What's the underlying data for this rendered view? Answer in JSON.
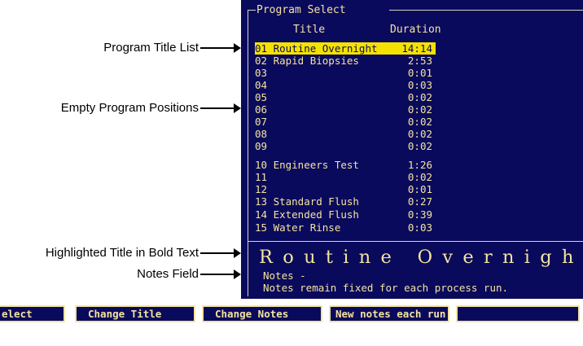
{
  "program_select": {
    "frame_title": "Program Select",
    "col_title": "Title",
    "col_duration": "Duration",
    "rows": [
      {
        "title": "01 Routine Overnight",
        "duration": "14:14",
        "selected": true
      },
      {
        "title": "02 Rapid Biopsies",
        "duration": "2:53"
      },
      {
        "title": "03",
        "duration": "0:01"
      },
      {
        "title": "04",
        "duration": "0:03"
      },
      {
        "title": "05",
        "duration": "0:02"
      },
      {
        "title": "06",
        "duration": "0:02"
      },
      {
        "title": "07",
        "duration": "0:02"
      },
      {
        "title": "08",
        "duration": "0:02"
      },
      {
        "title": "09",
        "duration": "0:02"
      },
      {
        "title": "10 Engineers Test",
        "duration": "1:26"
      },
      {
        "title": "11",
        "duration": "0:02"
      },
      {
        "title": "12",
        "duration": "0:01"
      },
      {
        "title": "13 Standard Flush",
        "duration": "0:27"
      },
      {
        "title": "14 Extended Flush",
        "duration": "0:39"
      },
      {
        "title": "15 Water Rinse",
        "duration": "0:03"
      }
    ],
    "highlighted_title": "Routine Overnight",
    "notes_label": "Notes -",
    "notes_text": "Notes remain fixed for each process run."
  },
  "annotations": {
    "program_title_list": "Program Title List",
    "empty_positions": "Empty Program Positions",
    "highlighted_bold": "Highlighted Title in Bold Text",
    "notes_field": "Notes Field"
  },
  "softkeys": [
    {
      "label": "elect"
    },
    {
      "label": "Change Title"
    },
    {
      "label": "Change Notes"
    },
    {
      "label": "New notes each run",
      "active": true
    },
    {
      "label": ""
    }
  ],
  "colors": {
    "screen_bg": "#0a0a5c",
    "text": "#f3e3a0",
    "highlight": "#f5e100"
  }
}
